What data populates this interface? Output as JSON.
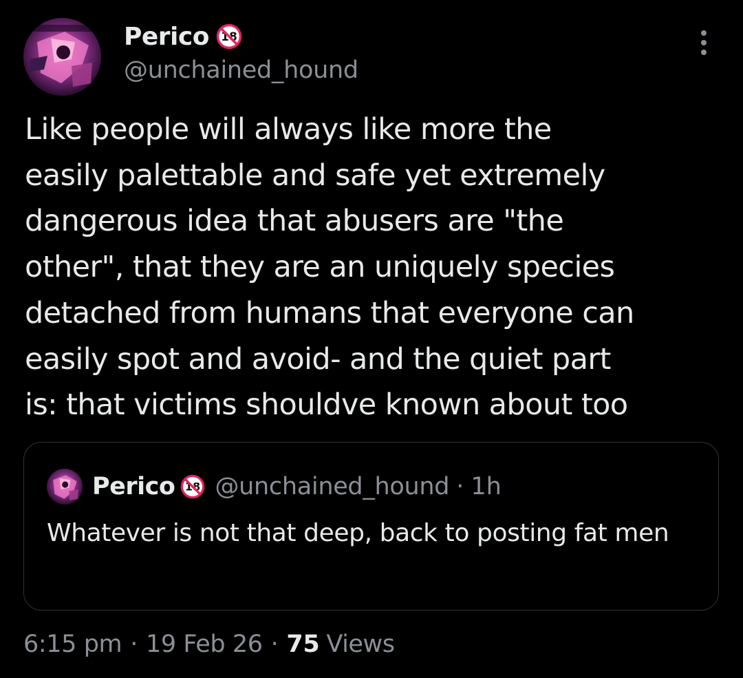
{
  "author": {
    "display_name": "Perico",
    "handle": "@unchained_hound",
    "badge_icon": "18-plus-badge-icon",
    "avatar_icon": "avatar-image"
  },
  "more_icon": "more-options-icon",
  "tweet": {
    "text": "Like people will always like more the\neasily palettable and safe yet extremely\ndangerous idea that abusers are \"the\nother\", that they are an uniquely species\ndetached from humans that everyone can\neasily spot and avoid- and the quiet part\nis: that victims shouldve known about too"
  },
  "quote": {
    "display_name": "Perico",
    "handle": "@unchained_hound",
    "separator": "·",
    "time": "1h",
    "text": "Whatever is not that deep, back to posting fat men"
  },
  "meta": {
    "time": "6:15 pm",
    "separator": "·",
    "date": "19 Feb 26",
    "views_count": "75",
    "views_label": "Views"
  },
  "colors": {
    "background": "#000000",
    "text": "#e7e9ea",
    "secondary": "#8b9097",
    "border": "#2f3336",
    "badge_red": "#e0245e"
  }
}
